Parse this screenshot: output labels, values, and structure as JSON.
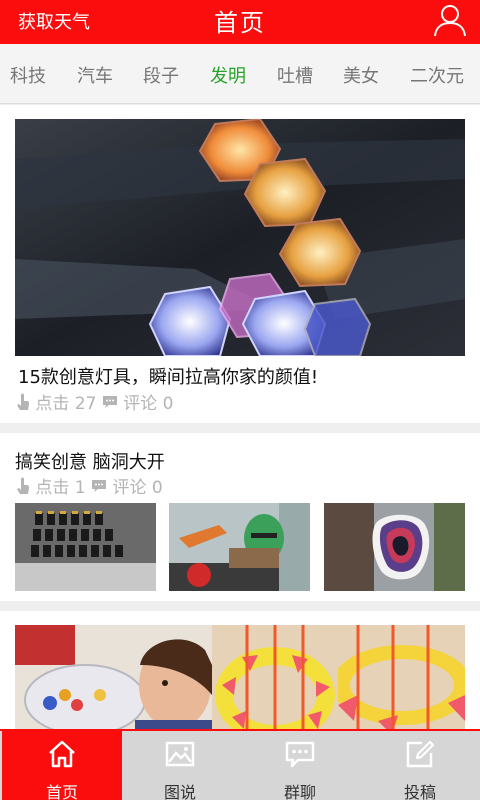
{
  "header": {
    "weather_label": "获取天气",
    "title": "首页",
    "user_icon": "user-icon"
  },
  "tabs": [
    {
      "label": "科技"
    },
    {
      "label": "汽车"
    },
    {
      "label": "段子"
    },
    {
      "label": "发明",
      "active": true
    },
    {
      "label": "吐槽"
    },
    {
      "label": "美女"
    },
    {
      "label": "二次元"
    }
  ],
  "feed": [
    {
      "title": "15款创意灯具，瞬间拉高你家的颜值!",
      "clicks_label": "点击 27",
      "comments_label": "评论 0"
    },
    {
      "title": "搞笑创意 脑洞大开",
      "clicks_label": "点击 1",
      "comments_label": "评论 0"
    }
  ],
  "bottom_nav": [
    {
      "label": "首页",
      "icon": "home-icon",
      "active": true
    },
    {
      "label": "图说",
      "icon": "image-icon"
    },
    {
      "label": "群聊",
      "icon": "chat-icon"
    },
    {
      "label": "投稿",
      "icon": "edit-icon"
    }
  ],
  "colors": {
    "brand_red": "#fb0d0d",
    "active_tab": "#2aa12a",
    "meta_gray": "#b4b4b4"
  }
}
